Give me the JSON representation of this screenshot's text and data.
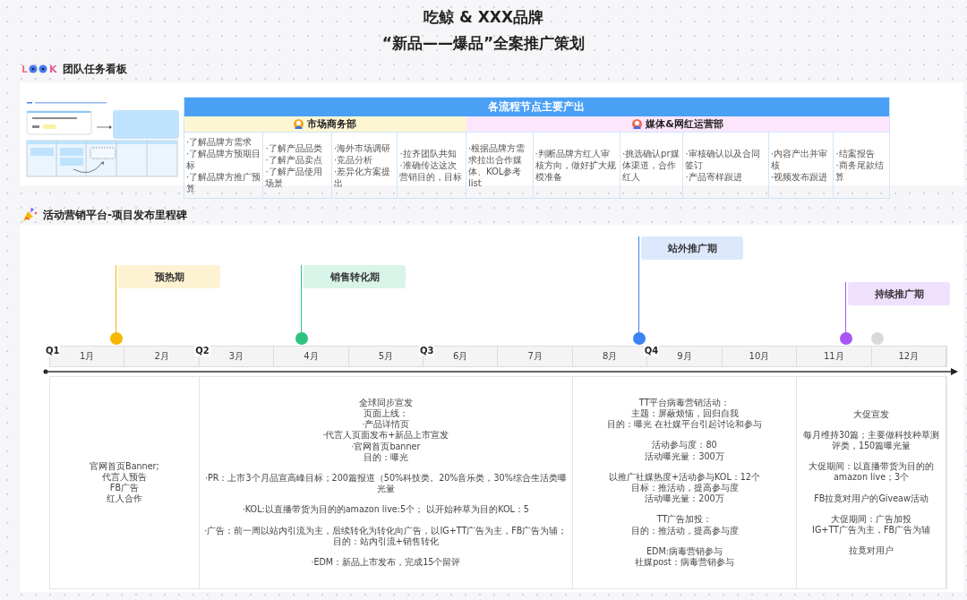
{
  "title": {
    "line1": "吃鲸 & XXX品牌",
    "line2": "“新品——爆品”全案推广策划"
  },
  "board_section": {
    "logo": {
      "left": "L",
      "right": "K"
    },
    "title": "团队任务看板",
    "table": {
      "header": "各流程节点主要产出",
      "departments": [
        {
          "name": "市场商务部",
          "color": "#fdf6d3"
        },
        {
          "name": "媒体&网红运营部",
          "color": "#fde6fb"
        }
      ],
      "cells": [
        [
          "·了解品牌方需求",
          "·了解品牌方预期目标",
          "·了解品牌方推广预算"
        ],
        [
          "·了解产品品类",
          "·了解产品卖点",
          "·了解产品使用场景"
        ],
        [
          "·海外市场调研",
          "·竞品分析",
          "·差异化方案提出"
        ],
        [
          "·拉齐团队共知",
          "·准确传达这次营销目的，目标"
        ],
        [
          "·根据品牌方需求拉出合作媒体、KOL参考list"
        ],
        [
          "·判断品牌方红人审核方向，做好扩大规模准备"
        ],
        [
          "·挑选确认pr媒体渠道，合作红人"
        ],
        [
          "·审核确认以及合同签订",
          "·产品寄样跟进"
        ],
        [
          "·内容产出并审核",
          "·视频发布跟进"
        ],
        [
          "·结案报告",
          "·商务尾款结算"
        ]
      ]
    }
  },
  "timeline_section": {
    "title": "活动营销平台-项目发布里程碑",
    "milestones": [
      {
        "label": "预热期",
        "color": "#f5b800"
      },
      {
        "label": "销售转化期",
        "color": "#2ec27e"
      },
      {
        "label": "站外推广期",
        "color": "#3b82f6"
      },
      {
        "label": "持续推广期",
        "color": "#a855f7"
      },
      {
        "color": "#d9d9d9"
      }
    ],
    "quarters": [
      "Q1",
      "Q2",
      "Q3",
      "Q4"
    ],
    "months": [
      "1月",
      "2月",
      "3月",
      "4月",
      "5月",
      "6月",
      "7月",
      "8月",
      "9月",
      "10月",
      "11月",
      "12月"
    ],
    "phases": [
      {
        "paragraphs": [
          [
            "官网首页Banner;",
            "代言人预告",
            "FB广告",
            "红人合作"
          ]
        ]
      },
      {
        "paragraphs": [
          [
            "全球同步宣发",
            "页面上线：",
            "·产品详情页",
            "·代言人页面发布+新品上市宣发",
            "·官网首页banner",
            "目的：曝光"
          ],
          [
            "·PR：上市3个月品宣高峰目标；200篇报道（50%科技类。20%音乐类，30%综合生活类曝光量"
          ],
          [
            "·KOL:以直播带货为目的的amazon live:5个；  以开始种草为目的KOL：5"
          ],
          [
            "·广告：前一周以站内引流为主，后续转化为转化向广告，以IG+TT广告为主，FB广告为辅；",
            "目的：站内引流+销售转化"
          ],
          [
            "·EDM：新品上市发布，完成15个留评"
          ]
        ]
      },
      {
        "paragraphs": [
          [
            "TT平台病毒营销活动：",
            "主题：屏蔽烦恼，回归自我",
            "目的：曝光 在社媒平台引起讨论和参与"
          ],
          [
            "活动参与度：80",
            "活动曝光量：300万"
          ],
          [
            "以推广社媒热度+活动参与KOL：12个",
            "目标：推活动，提高参与度",
            "活动曝光量：200万"
          ],
          [
            "TT广告加投：",
            "目的：推活动，提高参与度"
          ],
          [
            "EDM:病毒营销参与",
            "社媒post：病毒营销参与"
          ]
        ]
      },
      {
        "paragraphs": [
          [
            "大促宣发"
          ],
          [
            "每月维持30篇；主要做科技种草测评类，150篇曝光量"
          ],
          [
            "大促期间：以直播带货为目的的amazon live；3个"
          ],
          [
            "FB拉竟对用户的Giveaw活动"
          ],
          [
            "大促期间：广告加投",
            "IG+TT广告为主，FB广告为辅"
          ],
          [
            "拉竟对用户"
          ]
        ]
      }
    ]
  }
}
